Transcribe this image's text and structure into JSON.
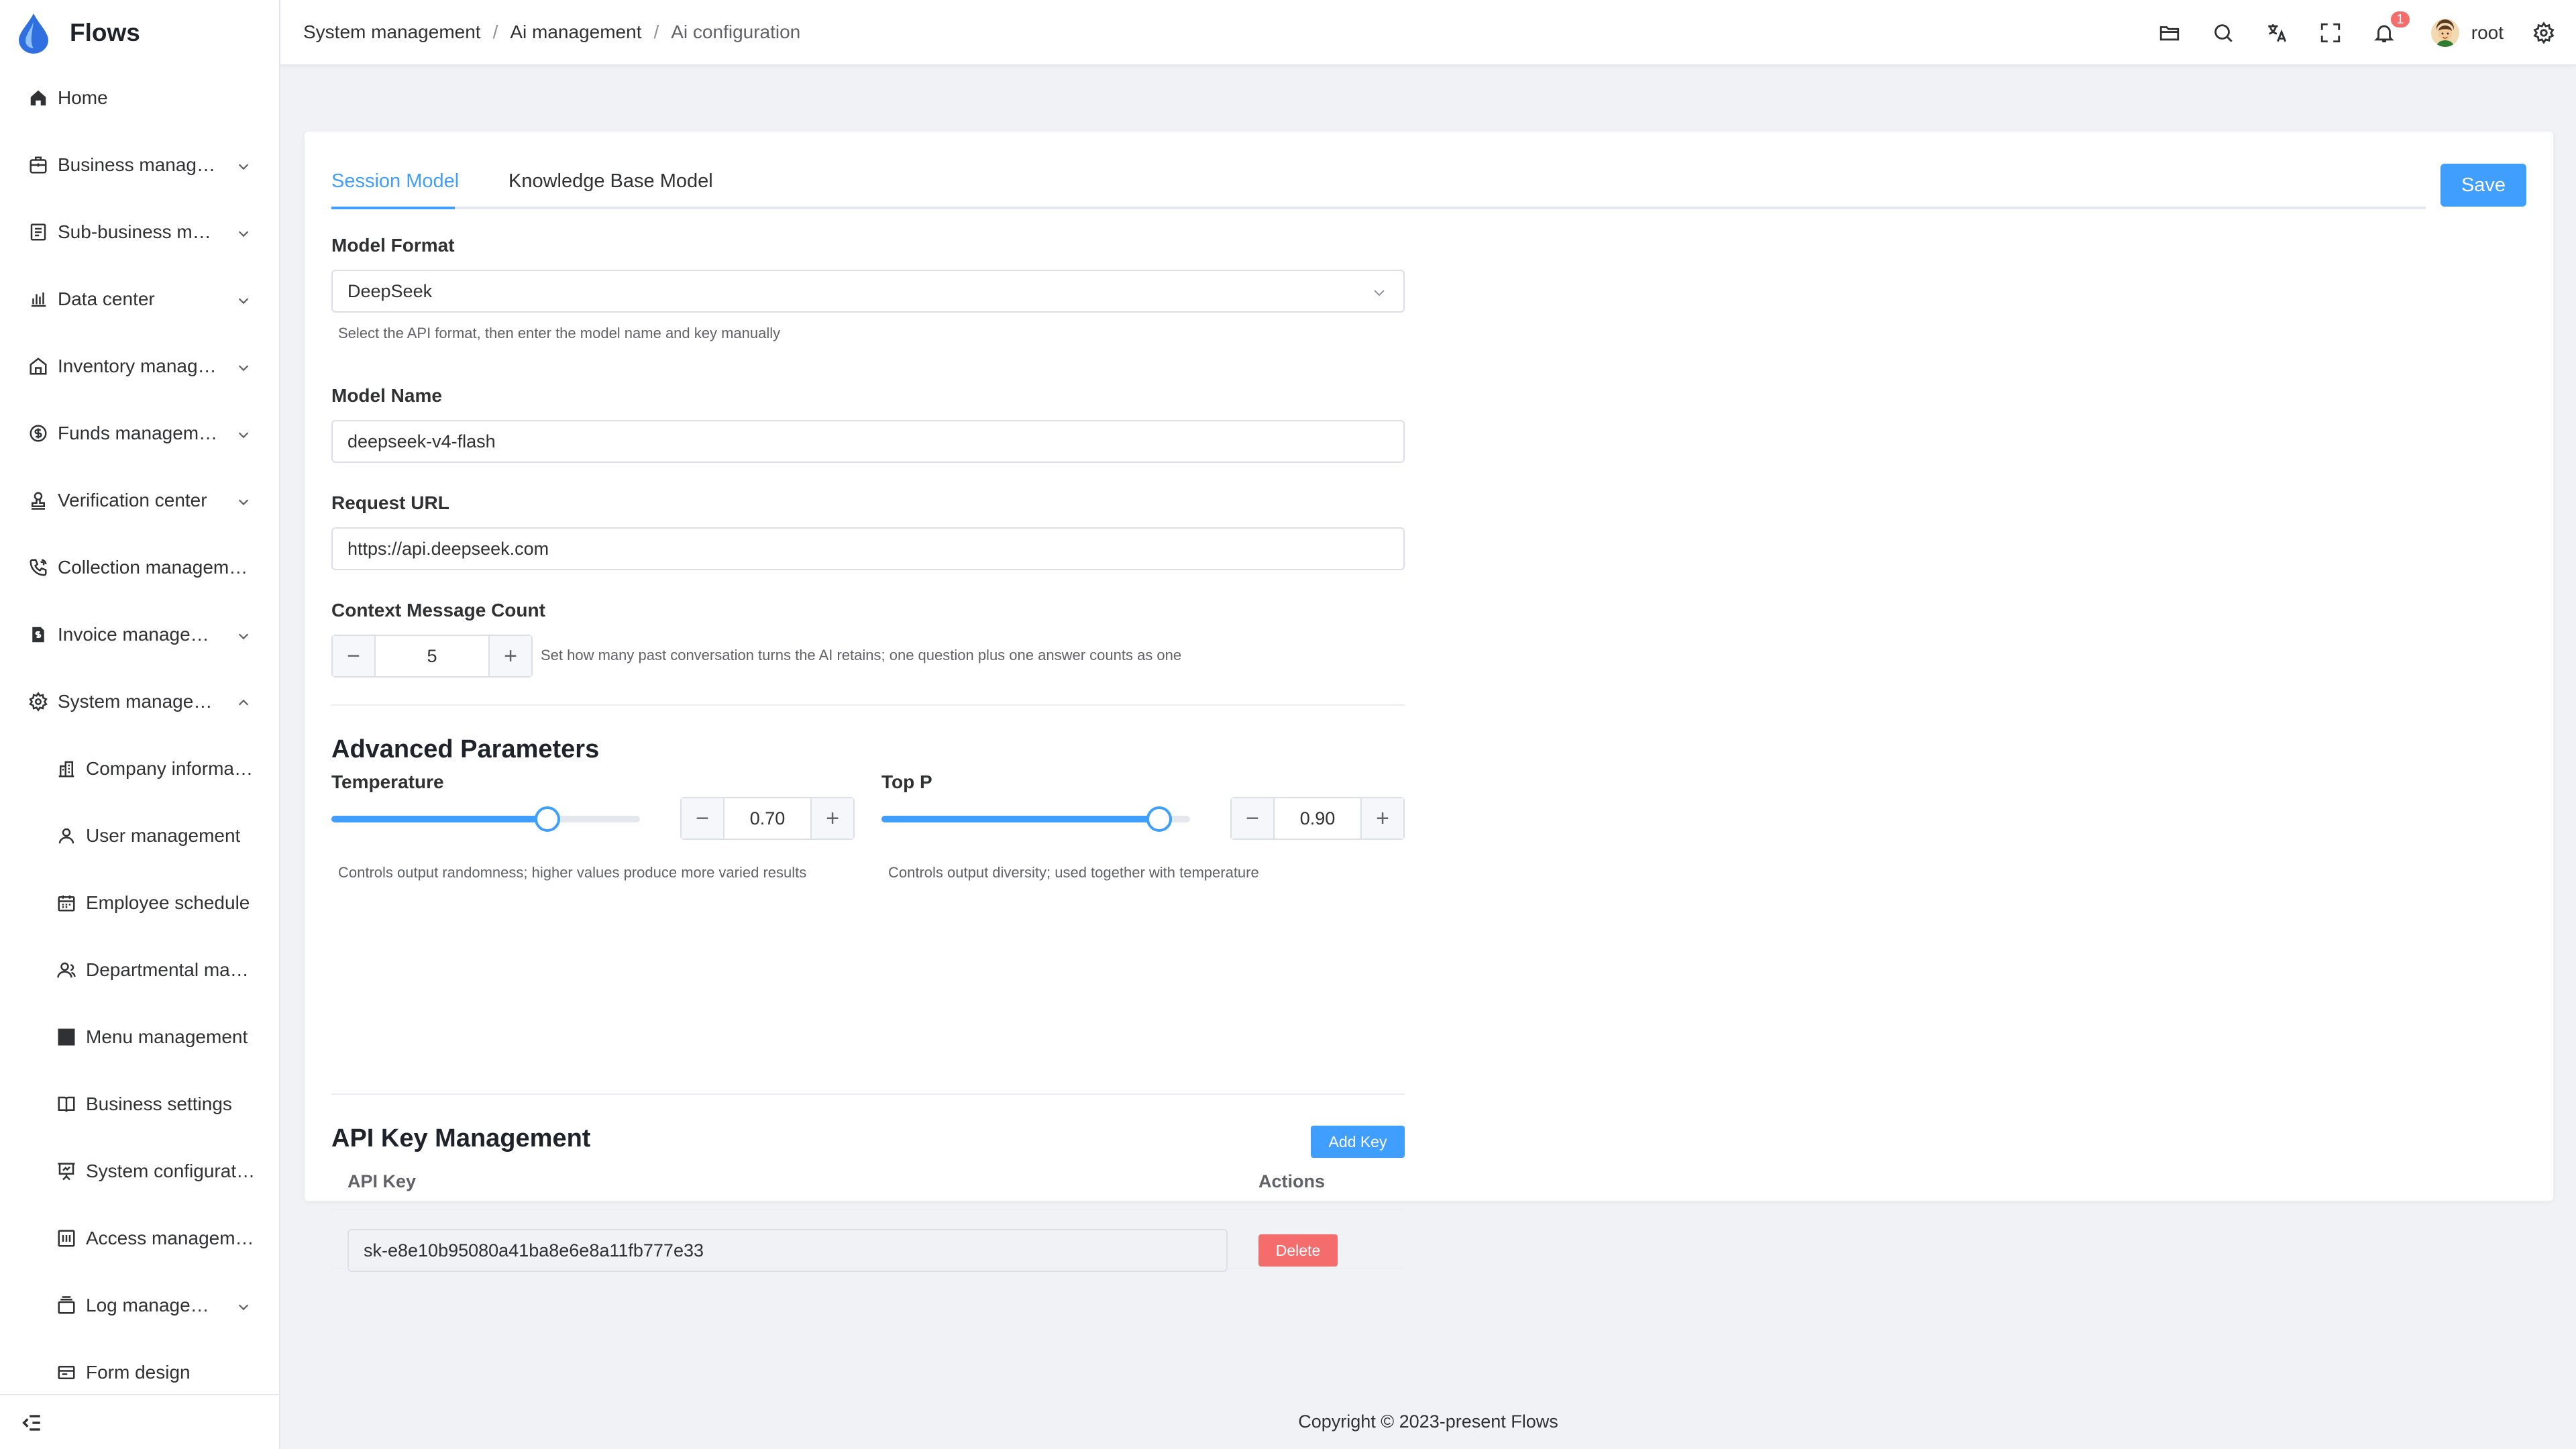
{
  "app": {
    "title": "Flows"
  },
  "sidebar": {
    "items": [
      {
        "label": "Home",
        "icon": "home-icon",
        "expandable": false
      },
      {
        "label": "Business manag…",
        "icon": "briefcase-icon",
        "expandable": true
      },
      {
        "label": "Sub-business m…",
        "icon": "document-icon",
        "expandable": true
      },
      {
        "label": "Data center",
        "icon": "bar-chart-icon",
        "expandable": true
      },
      {
        "label": "Inventory manag…",
        "icon": "warehouse-icon",
        "expandable": true
      },
      {
        "label": "Funds managem…",
        "icon": "dollar-icon",
        "expandable": true
      },
      {
        "label": "Verification center",
        "icon": "stamp-icon",
        "expandable": true
      },
      {
        "label": "Collection managem…",
        "icon": "phone-icon",
        "expandable": false
      },
      {
        "label": "Invoice manage…",
        "icon": "invoice-icon",
        "expandable": true
      },
      {
        "label": "System manage…",
        "icon": "gear-icon",
        "expandable": true,
        "expanded": true
      }
    ],
    "subitems": [
      {
        "label": "Company informa…",
        "icon": "building-icon"
      },
      {
        "label": "User management",
        "icon": "user-icon"
      },
      {
        "label": "Employee schedule",
        "icon": "calendar-icon"
      },
      {
        "label": "Departmental ma…",
        "icon": "users-icon"
      },
      {
        "label": "Menu management",
        "icon": "grid-icon"
      },
      {
        "label": "Business settings",
        "icon": "book-icon"
      },
      {
        "label": "System configurat…",
        "icon": "presentation-icon"
      },
      {
        "label": "Access managem…",
        "icon": "access-icon"
      },
      {
        "label": "Log manage…",
        "icon": "layers-icon",
        "expandable": true
      },
      {
        "label": "Form design",
        "icon": "form-icon"
      }
    ]
  },
  "header": {
    "breadcrumb": [
      "System management",
      "Ai management",
      "Ai configuration"
    ],
    "separator": "/",
    "notification_count": "1",
    "username": "root"
  },
  "tabs": [
    {
      "label": "Session Model",
      "active": true
    },
    {
      "label": "Knowledge Base Model",
      "active": false
    }
  ],
  "save_label": "Save",
  "form": {
    "model_format": {
      "label": "Model Format",
      "value": "DeepSeek",
      "hint": "Select the API format, then enter the model name and key manually"
    },
    "model_name": {
      "label": "Model Name",
      "value": "deepseek-v4-flash"
    },
    "request_url": {
      "label": "Request URL",
      "value": "https://api.deepseek.com"
    },
    "context_count": {
      "label": "Context Message Count",
      "value": "5",
      "hint": "Set how many past conversation turns the AI retains; one question plus one answer counts as one"
    }
  },
  "advanced": {
    "title": "Advanced Parameters",
    "temperature": {
      "label": "Temperature",
      "value": "0.70",
      "level": 0.7,
      "hint": "Controls output randomness; higher values produce more varied results"
    },
    "top_p": {
      "label": "Top P",
      "value": "0.90",
      "level": 0.9,
      "hint": "Controls output diversity; used together with temperature"
    }
  },
  "api_keys": {
    "title": "API Key Management",
    "add_label": "Add Key",
    "col_key": "API Key",
    "col_actions": "Actions",
    "rows": [
      {
        "key": "sk-e8e10b95080a41ba8e6e8a11fb777e33",
        "delete_label": "Delete"
      }
    ]
  },
  "footer": {
    "copyright": "Copyright © 2023-present Flows"
  },
  "colors": {
    "primary": "#409eff",
    "danger": "#f56c6c",
    "background": "#f0f2f5"
  }
}
